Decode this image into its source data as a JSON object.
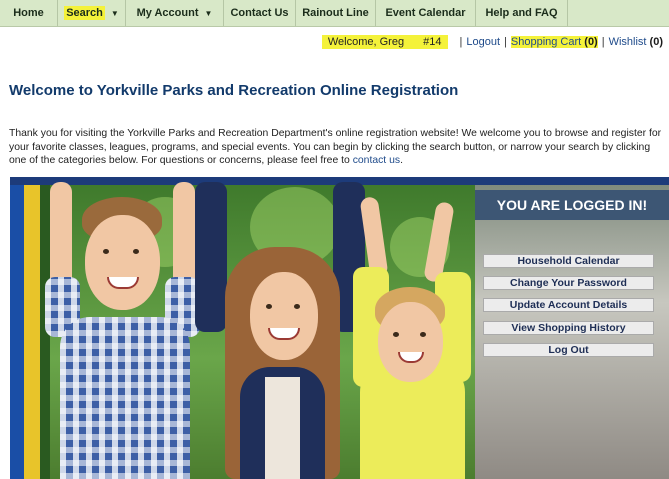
{
  "nav": [
    {
      "label": "Home",
      "caret": false,
      "highlight": false
    },
    {
      "label": "Search",
      "caret": true,
      "highlight": true
    },
    {
      "label": "My Account",
      "caret": true,
      "highlight": false
    },
    {
      "label": "Contact Us",
      "caret": false,
      "highlight": false
    },
    {
      "label": "Rainout Line",
      "caret": false,
      "highlight": false
    },
    {
      "label": "Event Calendar",
      "caret": false,
      "highlight": false
    },
    {
      "label": "Help and FAQ",
      "caret": false,
      "highlight": false
    }
  ],
  "userbar": {
    "welcome": "Welcome, Greg",
    "member_no": "#14",
    "logout": "Logout",
    "cart_label": "Shopping Cart",
    "cart_count": "(0)",
    "wishlist_label": "Wishlist",
    "wishlist_count": "(0)"
  },
  "title": "Welcome to Yorkville Parks and Recreation Online Registration",
  "intro": {
    "text": "Thank you for visiting the Yorkville Parks and Recreation Department's online registration website! We welcome you to browse and register for your favorite classes, leagues, programs, and special events. You can begin by clicking the search button, or narrow your search by clicking one of the categories below. For questions or concerns, please feel free to ",
    "link": "contact us",
    "end": "."
  },
  "panel": {
    "heading": "YOU ARE LOGGED IN!",
    "buttons": [
      "Household Calendar",
      "Change Your Password",
      "Update Account Details",
      "View Shopping History",
      "Log Out"
    ]
  },
  "colors": {
    "nav_bg": "#d8e8c8",
    "highlight": "#f4f23a",
    "title": "#123a6b",
    "panel_head": "#3d5674"
  }
}
